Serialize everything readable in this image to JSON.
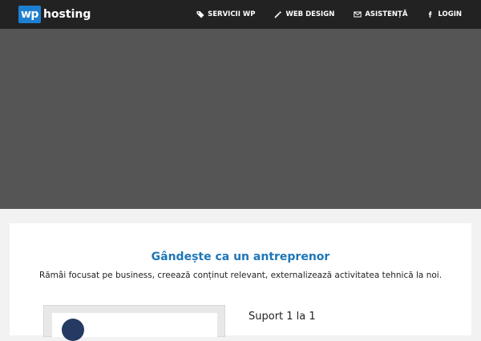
{
  "header": {
    "logo_badge": "wp",
    "logo_text": "hosting",
    "nav": [
      {
        "label": "SERVICII WP",
        "icon": "tags-icon"
      },
      {
        "label": "WEB DESIGN",
        "icon": "magic-wand-icon"
      },
      {
        "label": "ASISTENȚĂ",
        "icon": "envelope-icon"
      },
      {
        "label": "LOGIN",
        "icon": "facebook-icon"
      }
    ]
  },
  "colors": {
    "topbar": "#222222",
    "hero": "#555555",
    "accent": "#1e76b8",
    "logo_badge": "#1e7fd0"
  },
  "main": {
    "headline": "Gândește ca un antreprenor",
    "subline": "Rămâi focusat pe business, creează conținut relevant, externalizează activitatea tehnică la noi.",
    "feature_title": "Suport 1 la 1"
  }
}
